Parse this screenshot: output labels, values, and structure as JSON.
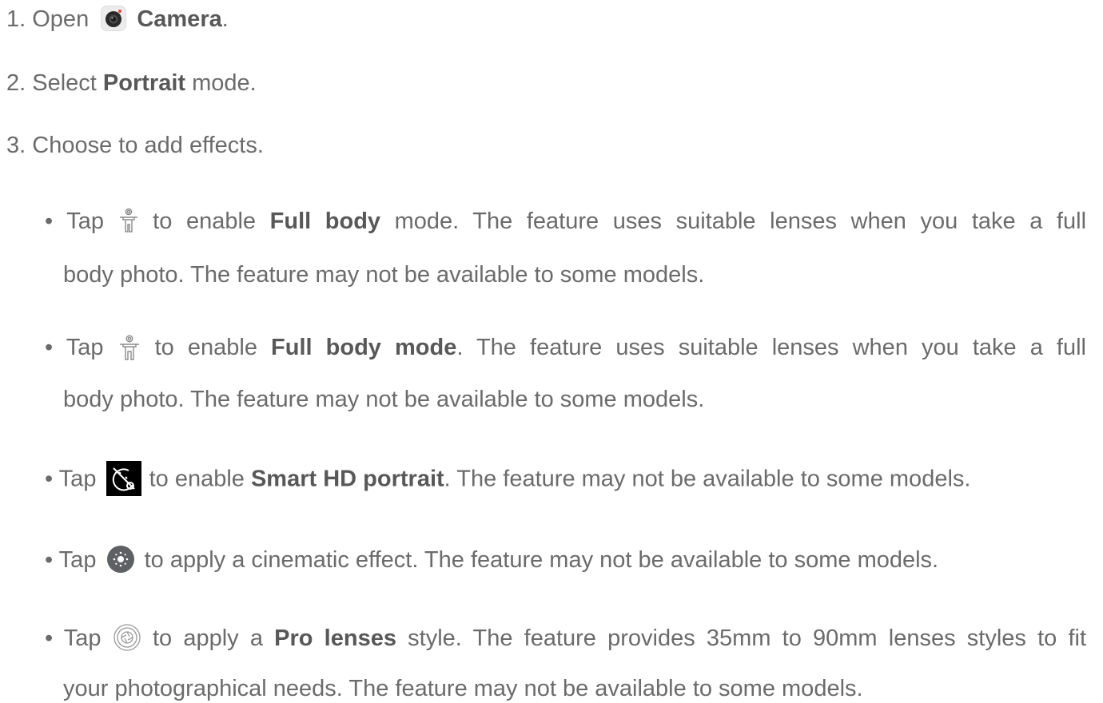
{
  "steps": [
    {
      "num": "1.",
      "pre": "Open",
      "app": "Camera",
      "post": "."
    },
    {
      "num": "2.",
      "pre": "Select",
      "bold": "Portrait",
      "post": "mode."
    },
    {
      "num": "3.",
      "text": "Choose to add effects."
    }
  ],
  "bullets": [
    {
      "icon": "full-body-icon",
      "pre": "• Tap",
      "mid": "to enable",
      "bold": "Full body",
      "line1_rest": "mode. The feature uses suitable lenses when you take a full",
      "line2": "body photo. The feature may not be available to some models."
    },
    {
      "icon": "full-body-icon",
      "pre": "• Tap",
      "mid": "to enable",
      "bold": "Full body mode",
      "line1_rest": ". The feature uses suitable lenses when you take a full",
      "line2": "body photo. The feature may not be available to some models."
    },
    {
      "icon": "smart-hd-portrait-icon",
      "pre": "• Tap",
      "mid": "to enable",
      "bold": "Smart HD portrait",
      "line1_rest": ". The feature may not be available to some models."
    },
    {
      "icon": "cinematic-effect-icon",
      "pre": "• Tap",
      "line1_rest": "to apply a cinematic effect. The feature may not be available to some models."
    },
    {
      "icon": "pro-lenses-icon",
      "pre": "• Tap",
      "mid": "to apply a",
      "bold": "Pro lenses",
      "line1_rest": "style. The feature provides 35mm to 90mm lenses styles to fit",
      "line2": "your photographical needs. The feature may not be available to some models."
    }
  ],
  "colors": {
    "text": "#6b6b6b",
    "bold_text": "#585858",
    "camera_icon_red": "#e8453c",
    "smart_hd_icon_bg": "#000000",
    "cinematic_icon_bg": "#5f6064"
  }
}
